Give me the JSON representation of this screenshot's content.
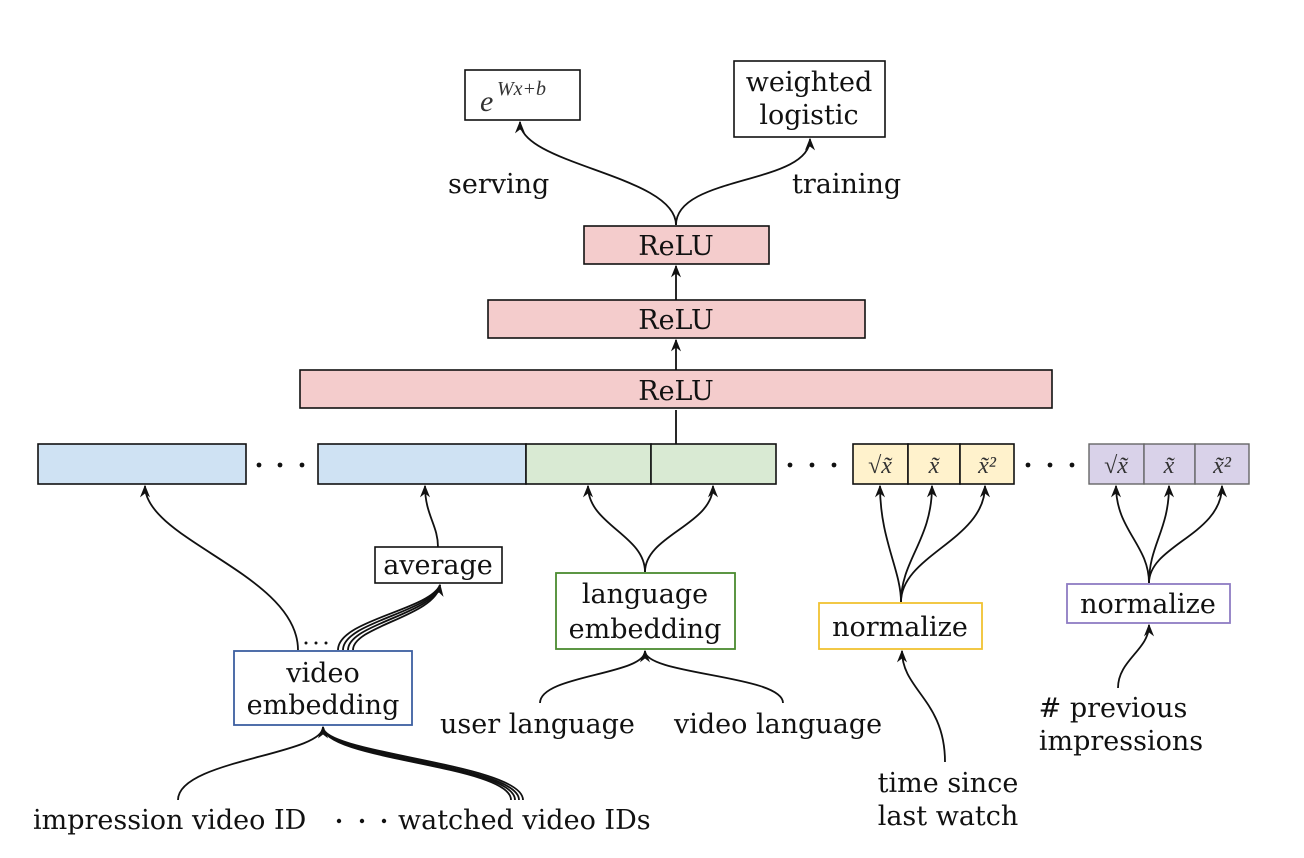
{
  "outputs": {
    "serving_box": "e^{Wx+b}",
    "serving_box_base": "e",
    "serving_box_exp": "Wx+b",
    "training_box": [
      "weighted",
      "logistic"
    ],
    "serving_label": "serving",
    "training_label": "training"
  },
  "layers": [
    {
      "label": "ReLU"
    },
    {
      "label": "ReLU"
    },
    {
      "label": "ReLU"
    }
  ],
  "embedding_row": {
    "segments": [
      {
        "kind": "video",
        "color": "#cfe2f3"
      },
      {
        "kind": "video",
        "color": "#cfe2f3"
      },
      {
        "kind": "language",
        "color": "#d9ead3"
      },
      {
        "kind": "language",
        "color": "#d9ead3"
      }
    ],
    "time_features": [
      "√x̃",
      "x̃",
      "x̃²"
    ],
    "impression_features": [
      "√x̃",
      "x̃",
      "x̃²"
    ]
  },
  "nodes": {
    "average": "average",
    "video_embedding": [
      "video",
      "embedding"
    ],
    "language_embedding": [
      "language",
      "embedding"
    ],
    "normalize_time": "normalize",
    "normalize_impressions": "normalize"
  },
  "inputs": {
    "impression_video_id": "impression video ID",
    "watched_video_ids": "watched video IDs",
    "user_language": "user language",
    "video_language": "video language",
    "time_since_last_watch": [
      "time since",
      "last watch"
    ],
    "previous_impressions": [
      "# previous",
      "impressions"
    ]
  },
  "colors": {
    "relu_fill": "#f4cccc",
    "video_fill": "#cfe2f3",
    "language_fill": "#d9ead3",
    "time_fill": "#fff2cc",
    "impression_fill": "#d9d2e9",
    "video_border": "#3c5fa0",
    "language_border": "#4a8a30",
    "time_border": "#f1c232",
    "impression_border": "#8e7cc3"
  }
}
